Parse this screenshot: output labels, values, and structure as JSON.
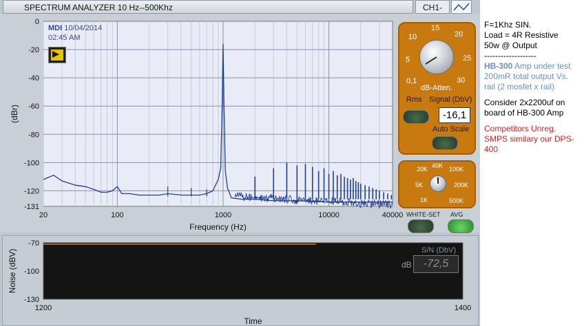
{
  "window": {
    "title": "SPECTRUM ANALYZER  10 Hz--500Khz",
    "channel": "CH1-",
    "waveform_icon": "waveform-icon"
  },
  "stamp": {
    "mdi": "MDI",
    "date": "10/04/2014",
    "time": "02:45 AM"
  },
  "spectrum": {
    "xlabel": "Frequency (Hz)",
    "ylabel": "(dBr)",
    "x_ticks": [
      "20",
      "100",
      "1000",
      "10000",
      "40000"
    ],
    "y_ticks": [
      "0",
      "-20",
      "-40",
      "-60",
      "-80",
      "-100",
      "-120",
      "-131"
    ]
  },
  "chart_data": [
    {
      "type": "line",
      "xscale": "log",
      "xlabel": "Frequency (Hz)",
      "ylabel": "(dBr)",
      "xlim": [
        20,
        40000
      ],
      "ylim": [
        -131,
        0
      ],
      "grid": true,
      "color": "#1f3f8f",
      "x": [
        20,
        25,
        30,
        40,
        50,
        60,
        70,
        80,
        90,
        100,
        110,
        130,
        160,
        200,
        250,
        300,
        400,
        500,
        600,
        700,
        800,
        900,
        950,
        980,
        1000,
        1020,
        1050,
        1100,
        1200,
        1500,
        2000,
        3000,
        5000,
        10000,
        20000,
        40000
      ],
      "y": [
        -112,
        -109,
        -113,
        -116,
        -117,
        -119,
        -121,
        -121,
        -120,
        -117,
        -122,
        -122,
        -123,
        -123,
        -123,
        -122,
        -123,
        -123,
        -123,
        -122,
        -120,
        -112,
        -104,
        -60,
        -16,
        -60,
        -106,
        -118,
        -125,
        -126,
        -126,
        -127,
        -127,
        -128,
        -128,
        -128
      ],
      "harmonics": [
        {
          "f": 2000,
          "db": -110
        },
        {
          "f": 3000,
          "db": -104
        },
        {
          "f": 4000,
          "db": -100
        },
        {
          "f": 5000,
          "db": -102
        },
        {
          "f": 6000,
          "db": -101
        },
        {
          "f": 7000,
          "db": -103
        },
        {
          "f": 8000,
          "db": -106
        },
        {
          "f": 9000,
          "db": -104
        },
        {
          "f": 10000,
          "db": -108
        },
        {
          "f": 11000,
          "db": -106
        },
        {
          "f": 12000,
          "db": -109
        },
        {
          "f": 13000,
          "db": -108
        },
        {
          "f": 14000,
          "db": -110
        },
        {
          "f": 15000,
          "db": -111
        },
        {
          "f": 16000,
          "db": -112
        },
        {
          "f": 17000,
          "db": -111
        },
        {
          "f": 18000,
          "db": -113
        },
        {
          "f": 19000,
          "db": -114
        },
        {
          "f": 20000,
          "db": -115
        },
        {
          "f": 22000,
          "db": -116
        },
        {
          "f": 24000,
          "db": -117
        },
        {
          "f": 26000,
          "db": -118
        },
        {
          "f": 28000,
          "db": -119
        },
        {
          "f": 30000,
          "db": -120
        },
        {
          "f": 33000,
          "db": -121
        },
        {
          "f": 36000,
          "db": -122
        },
        {
          "f": 39000,
          "db": -123
        }
      ],
      "low_spikes": [
        {
          "f": 300,
          "db": -117
        },
        {
          "f": 500,
          "db": -118
        },
        {
          "f": 700,
          "db": -119
        }
      ]
    },
    {
      "type": "line",
      "xlabel": "Time",
      "ylabel": "Noise (dBV)",
      "xlim": [
        1200,
        1400
      ],
      "ylim": [
        -130,
        -70
      ],
      "x_ticks": [
        "1200",
        "1400"
      ],
      "y_ticks": [
        "-70",
        "-100",
        "-130"
      ],
      "color": "#e07020",
      "x": [
        1200,
        1330
      ],
      "y": [
        -71.5,
        -71.5
      ]
    }
  ],
  "attenuator": {
    "label": "dB-Atten.",
    "scale": [
      "0,1",
      "5",
      "10",
      "15",
      "20",
      "25",
      "30"
    ],
    "rms_label": "Rms",
    "signal_label": "Signal (DbV)",
    "signal_value": "-16,1",
    "auto_scale_label": "Auto Scale"
  },
  "range": {
    "scale": [
      "1K",
      "5K",
      "20K",
      "40K",
      "100K",
      "200K",
      "500K"
    ]
  },
  "buttons": {
    "white_set": "WHITE-SET",
    "avg": "AVG"
  },
  "noise": {
    "xlabel": "Time",
    "ylabel": "Noise (dBV)",
    "sn_label": "S/N (DbV)",
    "db_label": "dB",
    "sn_value": "-72,5"
  },
  "notes": {
    "line1": "F=1Khz SIN.",
    "line2": "Load = 4R Resistive",
    "line3": "50w @ Output",
    "divider": "-------------------",
    "hb_brand": "HB-300",
    "hb_rest": " Amp under test 200mR total output Vs. rail (2 mosfet x rail)",
    "consider": "Consider 2x2200uf on board of HB-300 Amp",
    "competitors": "Competitors Unreg. SMPS similary our  DPS-400"
  },
  "colors": {
    "plot_bg": "#e9ebf7",
    "trace": "#1f3f8f",
    "orange_panel": "#c87a10",
    "noise_trace": "#e07020",
    "note_blue": "#6a8fc0",
    "note_red": "#e02020"
  }
}
